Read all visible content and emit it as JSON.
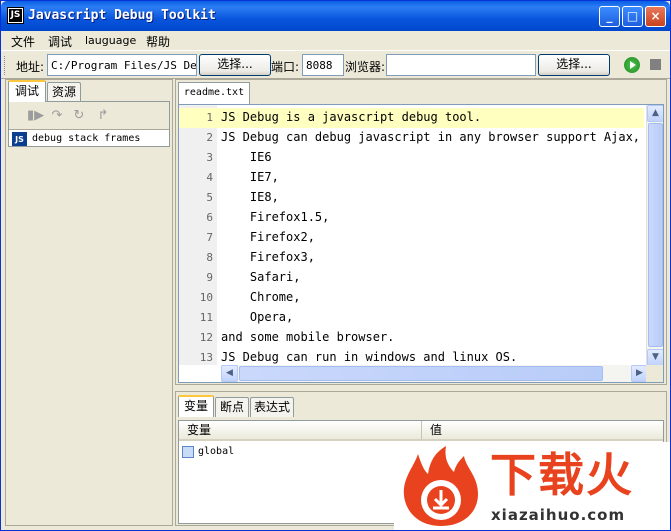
{
  "window": {
    "title": "Javascript Debug Toolkit",
    "icon_label": "JS",
    "controls": [
      "minimize-icon",
      "maximize-icon",
      "close-icon"
    ]
  },
  "menu": {
    "items": [
      "文件",
      "调试",
      "lauguage",
      "帮助"
    ]
  },
  "toolbar": {
    "address_label": "地址:",
    "address_value": "C:/Program Files/JS Debug",
    "choose_label": "选择...",
    "port_label": "端口:",
    "port_value": "8088",
    "browser_label": "浏览器:",
    "browser_value": "",
    "browser_choose_label": "选择...",
    "run_icon": "play-icon",
    "stop_icon": "stop-icon",
    "run_color": "#1F8A1F"
  },
  "left_panel": {
    "tabs": [
      {
        "label": "调试",
        "active": true
      },
      {
        "label": "资源",
        "active": false
      }
    ],
    "debug_tools": [
      "resume-icon",
      "step-over-icon",
      "step-into-icon",
      "step-out-icon"
    ],
    "stack_frames": [
      {
        "icon_label": "JS",
        "label": "debug stack frames"
      }
    ]
  },
  "editor": {
    "tab_label": "readme.txt",
    "lines": [
      {
        "num": "1",
        "text": "JS Debug is a javascript debug tool."
      },
      {
        "num": "2",
        "text": "JS Debug can debug javascript in any browser support Ajax, li"
      },
      {
        "num": "3",
        "text": "    IE6"
      },
      {
        "num": "4",
        "text": "    IE7,"
      },
      {
        "num": "5",
        "text": "    IE8,"
      },
      {
        "num": "6",
        "text": "    Firefox1.5,"
      },
      {
        "num": "7",
        "text": "    Firefox2,"
      },
      {
        "num": "8",
        "text": "    Firefox3,"
      },
      {
        "num": "9",
        "text": "    Safari,"
      },
      {
        "num": "10",
        "text": "    Chrome,"
      },
      {
        "num": "11",
        "text": "    Opera,"
      },
      {
        "num": "12",
        "text": "and some mobile browser."
      },
      {
        "num": "13",
        "text": "JS Debug can run in windows and linux OS."
      }
    ],
    "current_line_color": "#FFFFC0"
  },
  "bottom_panel": {
    "tabs": [
      {
        "label": "变量",
        "active": true
      },
      {
        "label": "断点",
        "active": false
      },
      {
        "label": "表达式",
        "active": false
      }
    ],
    "columns": [
      "变量",
      "值"
    ],
    "rows": [
      {
        "name": "global",
        "value": ""
      }
    ]
  },
  "watermark": {
    "brand_cn": "下载火",
    "url": "xiazaihuo.com",
    "brand_color": "#E8431E"
  }
}
